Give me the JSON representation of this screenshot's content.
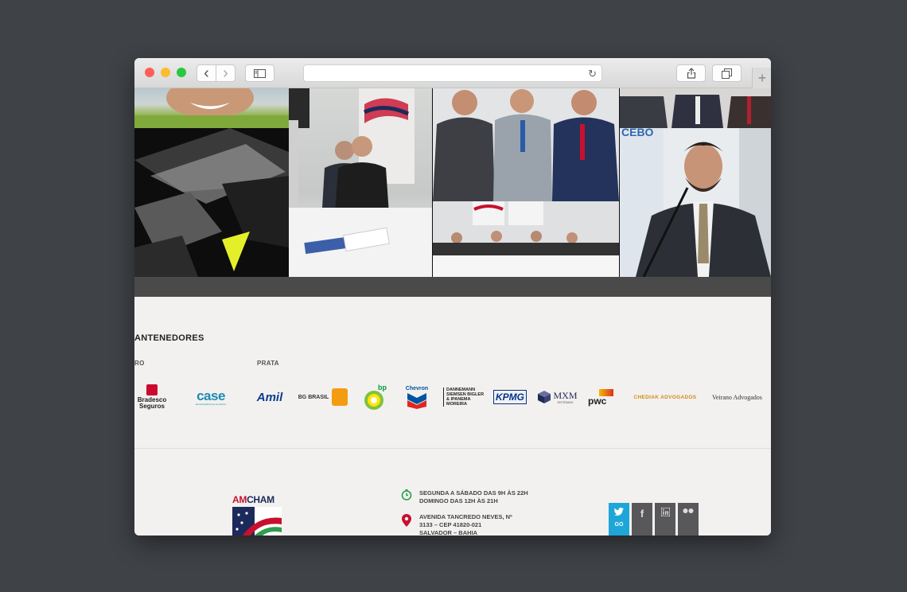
{
  "browser": {
    "url": "",
    "back_glyph": "‹",
    "forward_glyph": "›",
    "reload_glyph": "↻",
    "newtab_glyph": "+"
  },
  "sponsors": {
    "title": "ANTENEDORES",
    "categories": [
      {
        "label": "RO"
      },
      {
        "label": "PRATA"
      }
    ],
    "logos": {
      "bradesco": "Bradesco Seguros",
      "case": "case",
      "case_sub": "administradora de benefícios",
      "amil": "Amil",
      "bg": "BG BRASIL",
      "bp": "bp",
      "chevron": "Chevron",
      "dannemann": "DANNEMANN SIEMSEN BIGLER & IPANEMA MOREIRA",
      "kpmg": "KPMG",
      "mxm": "MXM",
      "mxm_sub": "SISTEMAS",
      "pwc": "pwc",
      "chediak": "CHEDIAK ADVOGADOS",
      "veirano": "Veirano Advogados"
    }
  },
  "footer": {
    "logo_am": "AM",
    "logo_cham": "CHAM",
    "hours_line1": "SEGUNDA A SÁBADO DAS 9H ÀS 22H",
    "hours_line2": "DOMINGO DAS 12H ÀS 21H",
    "address_line1": "AVENIDA TANCREDO NEVES, Nº",
    "address_line2": "3133 – CEP 41820-021",
    "address_line3": "SALVADOR – BAHIA",
    "social_go": "GO"
  },
  "colors": {
    "twitter": "#1fa6d9",
    "social_gray": "#58585b",
    "clock_green": "#2e9d4e",
    "pin_red": "#c8102e"
  }
}
